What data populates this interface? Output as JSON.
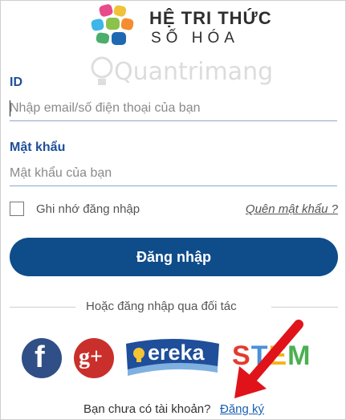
{
  "brand": {
    "name_line1": "HỆ TRI THỨC",
    "name_line2": "SỐ HÓA"
  },
  "watermark": {
    "text": "Quantrimang"
  },
  "form": {
    "id_label": "ID",
    "id_placeholder": "Nhập email/số điện thoại của bạn",
    "password_label": "Mật khẩu",
    "password_placeholder": "Mật khẩu của bạn",
    "remember_label": "Ghi nhớ đăng nhập",
    "forgot_label": "Quên mật khẩu ?",
    "login_button": "Đăng nhập"
  },
  "partners": {
    "divider_text": "Hoặc đăng nhập qua đối tác",
    "facebook_glyph": "f",
    "google_glyph": "g+",
    "ereka_text": "ereka",
    "stem_text": "STEM"
  },
  "signup": {
    "prompt": "Bạn chưa có tài khoản?",
    "link": "Đăng ký"
  },
  "colors": {
    "primary": "#0f4c8a",
    "label": "#1f4e9a",
    "facebook": "#2f4f86",
    "google": "#c9302c",
    "arrow": "#e0131b"
  }
}
